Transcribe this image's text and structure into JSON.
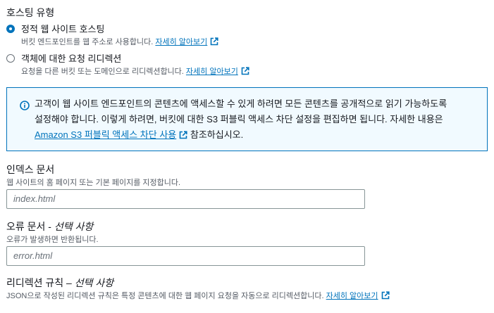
{
  "hosting": {
    "title": "호스팅 유형",
    "options": [
      {
        "label": "정적 웹 사이트 호스팅",
        "desc": "버킷 엔드포인트를 웹 주소로 사용합니다.",
        "link": "자세히 알아보기",
        "selected": true
      },
      {
        "label": "객체에 대한 요청 리디렉션",
        "desc": "요청을 다른 버킷 또는 도메인으로 리디렉션합니다.",
        "link": "자세히 알아보기",
        "selected": false
      }
    ]
  },
  "info": {
    "line1": "고객이 웹 사이트 엔드포인트의 콘텐츠에 액세스할 수 있게 하려면 모든 콘텐츠를 공개적으로 읽기 가능하도록",
    "line2": "설정해야 합니다. 이렇게 하려면, 버킷에 대한 S3 퍼블릭 액세스 차단 설정을 편집하면 됩니다. 자세한 내용은",
    "link": "Amazon S3 퍼블릭 액세스 차단 사용",
    "suffix": "참조하십시오."
  },
  "index_doc": {
    "label": "인덱스 문서",
    "desc": "웹 사이트의 홈 페이지 또는 기본 페이지를 지정합니다.",
    "placeholder": "index.html"
  },
  "error_doc": {
    "label": "오류 문서 -",
    "optional": "선택 사항",
    "desc": "오류가 발생하면 반환됩니다.",
    "placeholder": "error.html"
  },
  "redirect_rules": {
    "label": "리디렉션 규칙 –",
    "optional": "선택 사항",
    "desc": "JSON으로 작성된 리디렉션 규칙은 특정 콘텐츠에 대한 웹 페이지 요청을 자동으로 리디렉션합니다.",
    "link": "자세히 알아보기"
  },
  "colors": {
    "accent": "#0073bb",
    "info_bg": "#f1faff",
    "text": "#16191f",
    "muted": "#545b64"
  },
  "icons": [
    "external-link-icon",
    "info-icon"
  ]
}
